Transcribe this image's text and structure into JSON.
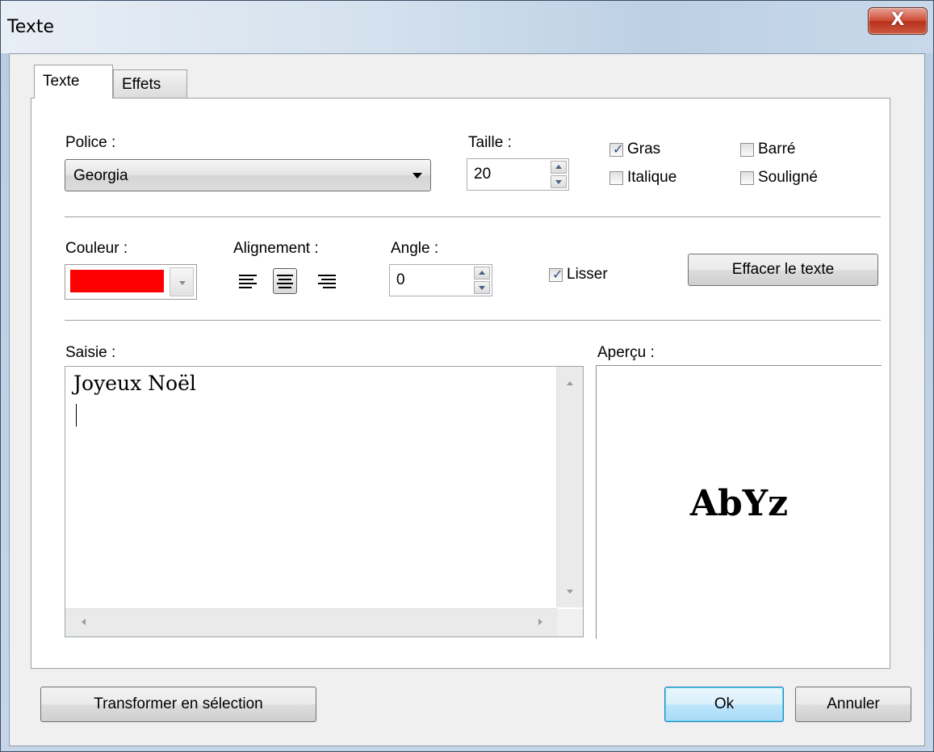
{
  "window": {
    "title": "Texte",
    "close_glyph": "X"
  },
  "tabs": [
    {
      "label": "Texte",
      "active": true
    },
    {
      "label": "Effets",
      "active": false
    }
  ],
  "font": {
    "label": "Police :",
    "value": "Georgia"
  },
  "size": {
    "label": "Taille :",
    "value": "20"
  },
  "style_options": {
    "bold": {
      "label": "Gras",
      "checked": true
    },
    "strike": {
      "label": "Barré",
      "checked": false
    },
    "italic": {
      "label": "Italique",
      "checked": false
    },
    "underline": {
      "label": "Souligné",
      "checked": false
    }
  },
  "color": {
    "label": "Couleur :",
    "value": "#ff0000"
  },
  "alignment": {
    "label": "Alignement :",
    "selected": "center",
    "options": [
      "left",
      "center",
      "right"
    ]
  },
  "angle": {
    "label": "Angle :",
    "value": "0"
  },
  "smooth": {
    "label": "Lisser",
    "checked": true
  },
  "clear_button": "Effacer le texte",
  "input": {
    "label": "Saisie :",
    "text": "Joyeux Noël"
  },
  "preview": {
    "label": "Aperçu :",
    "sample": "AbYz"
  },
  "footer": {
    "transform_button": "Transformer en sélection",
    "ok_button": "Ok",
    "cancel_button": "Annuler"
  }
}
